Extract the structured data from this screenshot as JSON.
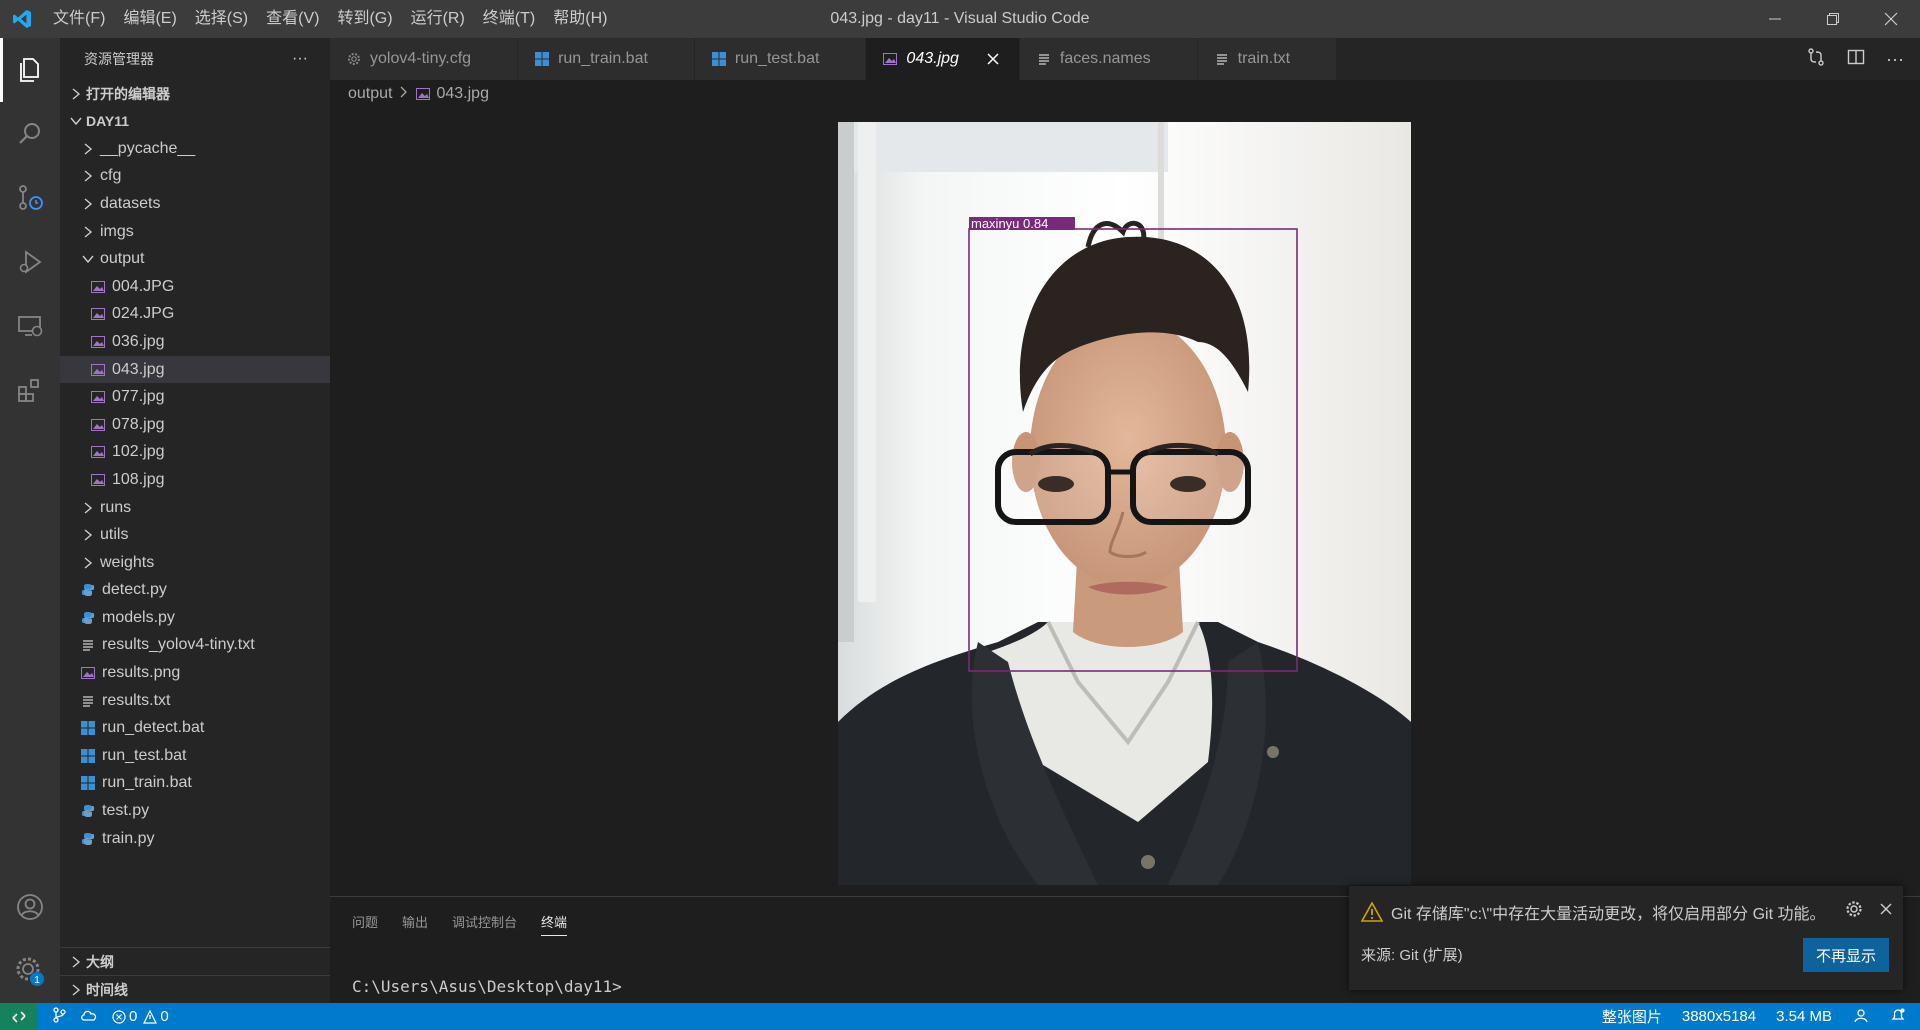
{
  "titlebar": {
    "menu": [
      "文件(F)",
      "编辑(E)",
      "选择(S)",
      "查看(V)",
      "转到(G)",
      "运行(R)",
      "终端(T)",
      "帮助(H)"
    ],
    "title": "043.jpg - day11 - Visual Studio Code"
  },
  "activitybar": {
    "items": [
      "files-icon",
      "search-icon",
      "source-control-icon",
      "run-debug-icon",
      "remote-explorer-icon",
      "extensions-icon"
    ],
    "bottom": [
      "account-icon",
      "manage-gear-icon"
    ],
    "badge": "1"
  },
  "sidebar": {
    "header": "资源管理器",
    "more": "···",
    "open_editors": "打开的编辑器",
    "root": "DAY11",
    "tree": [
      {
        "label": "__pycache__",
        "type": "folder",
        "depth": 1,
        "expanded": false
      },
      {
        "label": "cfg",
        "type": "folder",
        "depth": 1,
        "expanded": false
      },
      {
        "label": "datasets",
        "type": "folder",
        "depth": 1,
        "expanded": false
      },
      {
        "label": "imgs",
        "type": "folder",
        "depth": 1,
        "expanded": false
      },
      {
        "label": "output",
        "type": "folder",
        "depth": 1,
        "expanded": true
      },
      {
        "label": "004.JPG",
        "type": "image",
        "depth": 2
      },
      {
        "label": "024.JPG",
        "type": "image",
        "depth": 2
      },
      {
        "label": "036.jpg",
        "type": "image",
        "depth": 2
      },
      {
        "label": "043.jpg",
        "type": "image",
        "depth": 2,
        "selected": true
      },
      {
        "label": "077.jpg",
        "type": "image",
        "depth": 2
      },
      {
        "label": "078.jpg",
        "type": "image",
        "depth": 2
      },
      {
        "label": "102.jpg",
        "type": "image",
        "depth": 2
      },
      {
        "label": "108.jpg",
        "type": "image",
        "depth": 2
      },
      {
        "label": "runs",
        "type": "folder",
        "depth": 1,
        "expanded": false
      },
      {
        "label": "utils",
        "type": "folder",
        "depth": 1,
        "expanded": false
      },
      {
        "label": "weights",
        "type": "folder",
        "depth": 1,
        "expanded": false
      },
      {
        "label": "detect.py",
        "type": "python",
        "depth": 1
      },
      {
        "label": "models.py",
        "type": "python",
        "depth": 1
      },
      {
        "label": "results_yolov4-tiny.txt",
        "type": "text",
        "depth": 1
      },
      {
        "label": "results.png",
        "type": "image",
        "depth": 1
      },
      {
        "label": "results.txt",
        "type": "text",
        "depth": 1
      },
      {
        "label": "run_detect.bat",
        "type": "bat",
        "depth": 1
      },
      {
        "label": "run_test.bat",
        "type": "bat",
        "depth": 1
      },
      {
        "label": "run_train.bat",
        "type": "bat",
        "depth": 1
      },
      {
        "label": "test.py",
        "type": "python",
        "depth": 1
      },
      {
        "label": "train.py",
        "type": "python",
        "depth": 1
      }
    ],
    "outline": "大纲",
    "timeline": "时间线"
  },
  "tabs": [
    {
      "label": "yolov4-tiny.cfg",
      "icon": "gear-file-icon",
      "active": false
    },
    {
      "label": "run_train.bat",
      "icon": "windows-file-icon",
      "active": false
    },
    {
      "label": "run_test.bat",
      "icon": "windows-file-icon",
      "active": false
    },
    {
      "label": "043.jpg",
      "icon": "image-file-icon",
      "active": true
    },
    {
      "label": "faces.names",
      "icon": "text-file-icon",
      "active": false
    },
    {
      "label": "train.txt",
      "icon": "text-file-icon",
      "active": false
    }
  ],
  "breadcrumb": {
    "folder": "output",
    "file": "043.jpg"
  },
  "image": {
    "detection_label": "maxinyu 0.84",
    "box_color": "#7a2a7a"
  },
  "panel": {
    "tabs": [
      "问题",
      "输出",
      "调试控制台",
      "终端"
    ],
    "active_tab": "终端",
    "prompt": "C:\\Users\\Asus\\Desktop\\day11>"
  },
  "notification": {
    "message": "Git 存储库\"c:\\\"中存在大量活动更改，将仅启用部分 Git 功能。",
    "source": "来源: Git (扩展)",
    "button": "不再显示"
  },
  "statusbar": {
    "errors": "0",
    "warnings": "0",
    "zoom": "整张图片",
    "dimensions": "3880x5184",
    "size": "3.54 MB"
  },
  "colors": {
    "accent": "#007acc",
    "remote": "#16825d",
    "button": "#0e639c",
    "warning": "#cca700"
  }
}
